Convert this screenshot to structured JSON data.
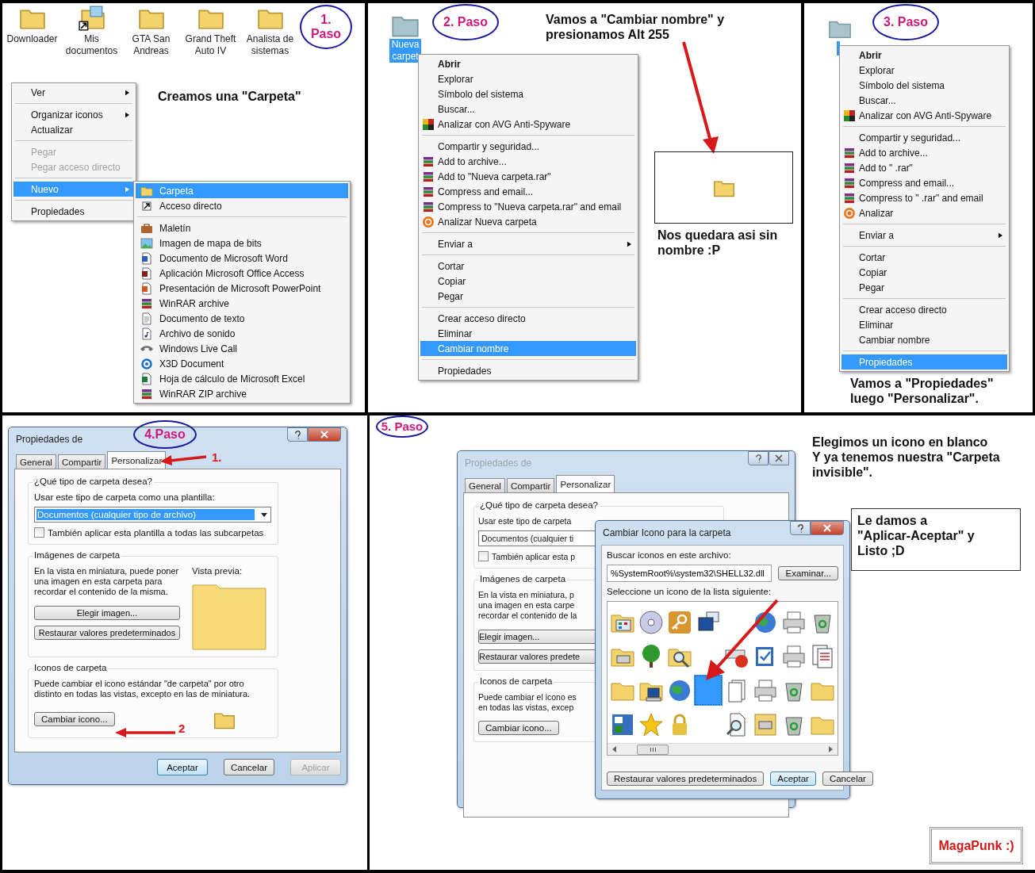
{
  "step1": {
    "badge": "1. Paso",
    "desktop_icons": [
      {
        "label": "Downloader",
        "kind": "folder"
      },
      {
        "label": "Mis\ndocumentos",
        "kind": "shortcut-folder"
      },
      {
        "label": "GTA San\nAndreas",
        "kind": "folder"
      },
      {
        "label": "Grand Theft\nAuto IV",
        "kind": "folder"
      },
      {
        "label": "Analista de\nsistemas",
        "kind": "folder"
      }
    ],
    "caption": "Creamos una \"Carpeta\"",
    "menu": [
      {
        "kind": "item",
        "label": "Ver",
        "submenu": true,
        "selected": false,
        "disabled": false
      },
      {
        "kind": "separator"
      },
      {
        "kind": "item",
        "label": "Organizar iconos",
        "submenu": true,
        "selected": false,
        "disabled": false
      },
      {
        "kind": "item",
        "label": "Actualizar",
        "selected": false,
        "disabled": false
      },
      {
        "kind": "separator"
      },
      {
        "kind": "item",
        "label": "Pegar",
        "selected": false,
        "disabled": true
      },
      {
        "kind": "item",
        "label": "Pegar acceso directo",
        "selected": false,
        "disabled": true
      },
      {
        "kind": "separator"
      },
      {
        "kind": "item",
        "label": "Nuevo",
        "submenu": true,
        "selected": true,
        "disabled": false
      },
      {
        "kind": "separator"
      },
      {
        "kind": "item",
        "label": "Propiedades",
        "selected": false,
        "disabled": false
      }
    ],
    "submenu": [
      {
        "kind": "item",
        "label": "Carpeta",
        "selected": true
      },
      {
        "kind": "item",
        "label": "Acceso directo",
        "selected": false
      },
      {
        "kind": "separator"
      },
      {
        "kind": "item",
        "label": "Maletín",
        "selected": false
      },
      {
        "kind": "item",
        "label": "Imagen de mapa de bits",
        "selected": false
      },
      {
        "kind": "item",
        "label": "Documento de Microsoft Word",
        "selected": false
      },
      {
        "kind": "item",
        "label": "Aplicación Microsoft Office Access",
        "selected": false
      },
      {
        "kind": "item",
        "label": "Presentación de Microsoft PowerPoint",
        "selected": false
      },
      {
        "kind": "item",
        "label": "WinRAR archive",
        "selected": false
      },
      {
        "kind": "item",
        "label": "Documento de texto",
        "selected": false
      },
      {
        "kind": "item",
        "label": "Archivo de sonido",
        "selected": false
      },
      {
        "kind": "item",
        "label": "Windows Live Call",
        "selected": false
      },
      {
        "kind": "item",
        "label": "X3D Document",
        "selected": false
      },
      {
        "kind": "item",
        "label": "Hoja de cálculo de Microsoft Excel",
        "selected": false
      },
      {
        "kind": "item",
        "label": "WinRAR ZIP archive",
        "selected": false
      }
    ]
  },
  "step2": {
    "badge": "2. Paso",
    "folder": {
      "label": "Nueva\ncarpet",
      "selected": true
    },
    "caption": "Vamos a \"Cambiar nombre\" y\npresionamos Alt 255",
    "result_caption": "Nos quedara asi sin\nnombre :P",
    "menu": [
      {
        "kind": "default",
        "label": "Abrir",
        "selected": false
      },
      {
        "kind": "item",
        "label": "Explorar",
        "selected": false
      },
      {
        "kind": "item",
        "label": "Símbolo del sistema",
        "selected": false
      },
      {
        "kind": "item",
        "label": "Buscar...",
        "selected": false
      },
      {
        "kind": "item",
        "label": "Analizar con AVG Anti-Spyware",
        "selected": false
      },
      {
        "kind": "separator"
      },
      {
        "kind": "item",
        "label": "Compartir y seguridad...",
        "selected": false
      },
      {
        "kind": "item",
        "label": "Add to archive...",
        "selected": false
      },
      {
        "kind": "item",
        "label": "Add to \"Nueva carpeta.rar\"",
        "selected": false
      },
      {
        "kind": "item",
        "label": "Compress and email...",
        "selected": false
      },
      {
        "kind": "item",
        "label": "Compress to \"Nueva carpeta.rar\" and email",
        "selected": false
      },
      {
        "kind": "item",
        "label": "Analizar Nueva carpeta",
        "selected": false
      },
      {
        "kind": "separator"
      },
      {
        "kind": "item",
        "label": "Enviar a",
        "submenu": true,
        "selected": false
      },
      {
        "kind": "separator"
      },
      {
        "kind": "item",
        "label": "Cortar",
        "selected": false
      },
      {
        "kind": "item",
        "label": "Copiar",
        "selected": false
      },
      {
        "kind": "item",
        "label": "Pegar",
        "selected": false
      },
      {
        "kind": "separator"
      },
      {
        "kind": "item",
        "label": "Crear acceso directo",
        "selected": false
      },
      {
        "kind": "item",
        "label": "Eliminar",
        "selected": false
      },
      {
        "kind": "item",
        "label": "Cambiar nombre",
        "selected": true
      },
      {
        "kind": "separator"
      },
      {
        "kind": "item",
        "label": "Propiedades",
        "selected": false
      }
    ]
  },
  "step3": {
    "badge": "3. Paso",
    "folder": {
      "selected": true
    },
    "caption": "Vamos a \"Propiedades\"\nluego \"Personalizar\".",
    "menu": [
      {
        "kind": "default",
        "label": "Abrir",
        "selected": false
      },
      {
        "kind": "item",
        "label": "Explorar",
        "selected": false
      },
      {
        "kind": "item",
        "label": "Símbolo del sistema",
        "selected": false
      },
      {
        "kind": "item",
        "label": "Buscar...",
        "selected": false
      },
      {
        "kind": "item",
        "label": "Analizar con AVG Anti-Spyware",
        "selected": false
      },
      {
        "kind": "separator"
      },
      {
        "kind": "item",
        "label": "Compartir y seguridad...",
        "selected": false
      },
      {
        "kind": "item",
        "label": "Add to archive...",
        "selected": false
      },
      {
        "kind": "item",
        "label": "Add to \" .rar\"",
        "selected": false
      },
      {
        "kind": "item",
        "label": "Compress and email...",
        "selected": false
      },
      {
        "kind": "item",
        "label": "Compress to \" .rar\" and email",
        "selected": false
      },
      {
        "kind": "item",
        "label": "Analizar",
        "selected": false
      },
      {
        "kind": "separator"
      },
      {
        "kind": "item",
        "label": "Enviar a",
        "submenu": true,
        "selected": false
      },
      {
        "kind": "separator"
      },
      {
        "kind": "item",
        "label": "Cortar",
        "selected": false
      },
      {
        "kind": "item",
        "label": "Copiar",
        "selected": false
      },
      {
        "kind": "item",
        "label": "Pegar",
        "selected": false
      },
      {
        "kind": "separator"
      },
      {
        "kind": "item",
        "label": "Crear acceso directo",
        "selected": false
      },
      {
        "kind": "item",
        "label": "Eliminar",
        "selected": false
      },
      {
        "kind": "item",
        "label": "Cambiar nombre",
        "selected": false
      },
      {
        "kind": "separator"
      },
      {
        "kind": "item",
        "label": "Propiedades",
        "selected": true
      }
    ]
  },
  "step4": {
    "badge": "4.Paso",
    "annotations": [
      "1.",
      "2"
    ],
    "dialog": {
      "title": "Propiedades de",
      "tabs": [
        {
          "label": "General",
          "selected": false
        },
        {
          "label": "Compartir",
          "selected": false
        },
        {
          "label": "Personalizar",
          "selected": true
        }
      ],
      "template_group": {
        "title": "¿Qué tipo de carpeta desea?",
        "label": "Usar este tipo de carpeta como una plantilla:",
        "dropdown": {
          "value": "Documentos (cualquier tipo de archivo)",
          "focused": true
        },
        "checkbox": {
          "label": "También aplicar esta plantilla a todas las subcarpetas",
          "checked": false
        }
      },
      "images_group": {
        "title": "Imágenes de carpeta",
        "text": "En la vista en miniatura, puede poner una imagen en esta carpeta para recordar el contenido de la misma.",
        "preview_label": "Vista previa:",
        "buttons": [
          "Elegir imagen...",
          "Restaurar valores predeterminados"
        ]
      },
      "icons_group": {
        "title": "Iconos de carpeta",
        "text": "Puede cambiar el icono estándar \"de carpeta\" por otro distinto en todas las vistas, excepto en las de miniatura.",
        "button": "Cambiar icono..."
      },
      "buttons": [
        {
          "label": "Aceptar",
          "kind": "default",
          "disabled": false
        },
        {
          "label": "Cancelar",
          "kind": "normal",
          "disabled": false
        },
        {
          "label": "Aplicar",
          "kind": "normal",
          "disabled": true
        }
      ]
    }
  },
  "step5": {
    "badge": "5. Paso",
    "caption": "Elegimos un icono en blanco\nY ya tenemos nuestra \"Carpeta\ninvisible\".",
    "note": "Le damos a\n\"Aplicar-Aceptar\" y\nListo ;D",
    "back_dialog": {
      "title": "Propiedades de",
      "tabs": [
        {
          "label": "General",
          "selected": false
        },
        {
          "label": "Compartir",
          "selected": false
        },
        {
          "label": "Personalizar",
          "selected": true
        }
      ],
      "template_group": {
        "title": "¿Qué tipo de carpeta desea?",
        "label": "Usar este tipo de carpeta",
        "dropdown": {
          "value": "Documentos (cualquier ti",
          "focused": false
        },
        "checkbox": {
          "label": "También aplicar esta p",
          "checked": false
        }
      },
      "images_group": {
        "title": "Imágenes de carpeta",
        "text": "En la vista en miniatura, p\nuna imagen en esta carpe\nrecordar el contenido de la",
        "buttons": [
          "Elegir imagen...",
          "Restaurar valores predete"
        ]
      },
      "icons_group": {
        "title": "Iconos de carpeta",
        "text": "Puede cambiar el icono es\nen todas las vistas, excep",
        "button": "Cambiar icono..."
      }
    },
    "icon_dialog": {
      "title": "Cambiar Icono para la carpeta",
      "file_label": "Buscar iconos en este archivo:",
      "file_value": "%SystemRoot%\\system32\\SHELL32.dll",
      "browse": "Examinar...",
      "list_label": "Seleccione un icono de la lista siguiente:",
      "icons": [
        {
          "kind": "control",
          "selected": false
        },
        {
          "kind": "disc",
          "selected": false
        },
        {
          "kind": "key",
          "selected": false
        },
        {
          "kind": "monitor",
          "selected": false
        },
        {
          "kind": "blank",
          "selected": false
        },
        {
          "kind": "globe",
          "selected": false
        },
        {
          "kind": "printer",
          "selected": false
        },
        {
          "kind": "bin",
          "selected": false
        },
        {
          "kind": "printer-folder",
          "selected": false
        },
        {
          "kind": "tree",
          "selected": false
        },
        {
          "kind": "search",
          "selected": false
        },
        {
          "kind": "blank",
          "selected": false
        },
        {
          "kind": "alert",
          "selected": false
        },
        {
          "kind": "check",
          "selected": false
        },
        {
          "kind": "printer",
          "selected": false
        },
        {
          "kind": "documents",
          "selected": false
        },
        {
          "kind": "folder32",
          "selected": false
        },
        {
          "kind": "computer",
          "selected": false
        },
        {
          "kind": "globe",
          "selected": false
        },
        {
          "kind": "blank",
          "selected": true
        },
        {
          "kind": "pages",
          "selected": false
        },
        {
          "kind": "printer",
          "selected": false
        },
        {
          "kind": "bin",
          "selected": false
        },
        {
          "kind": "folder32",
          "selected": false
        },
        {
          "kind": "window",
          "selected": false
        },
        {
          "kind": "star",
          "selected": false
        },
        {
          "kind": "lock",
          "selected": false
        },
        {
          "kind": "blank",
          "selected": false
        },
        {
          "kind": "docsearch",
          "selected": false
        },
        {
          "kind": "printframe",
          "selected": false
        },
        {
          "kind": "bin",
          "selected": false
        },
        {
          "kind": "folder32",
          "selected": false
        }
      ],
      "buttons": [
        {
          "label": "Restaurar valores predeterminados",
          "kind": "normal"
        },
        {
          "label": "Aceptar",
          "kind": "default"
        },
        {
          "label": "Cancelar",
          "kind": "normal"
        }
      ]
    }
  },
  "signature": "MagaPunk :)"
}
